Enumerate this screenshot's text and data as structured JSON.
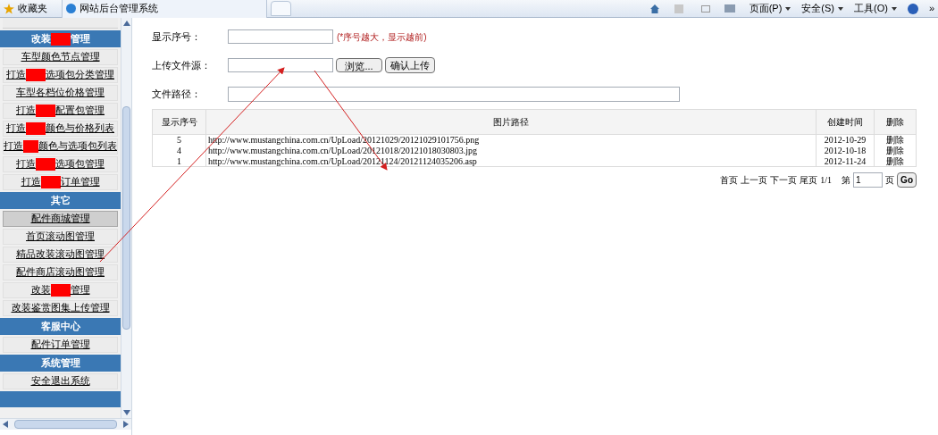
{
  "browser": {
    "favorites": "收藏夹",
    "tab": "网站后台管理系统",
    "menus": [
      "页面(P)",
      "安全(S)",
      "工具(O)"
    ],
    "more": "»"
  },
  "sidebar": {
    "sections": [
      {
        "title": {
          "before": "改装",
          "after": "管理",
          "redacted": true
        },
        "items": [
          {
            "before": "车型颜色节点管理",
            "selected": false
          },
          {
            "before": "打造",
            "after": "选项包分类管理",
            "redacted": true,
            "selected": false
          },
          {
            "before": "车型各档位价格管理",
            "selected": false
          },
          {
            "before": "打造",
            "after": "配置包管理",
            "redacted": true,
            "selected": false
          },
          {
            "before": "打造",
            "after": "颜色与价格列表",
            "redacted": true,
            "selected": false
          },
          {
            "before": "打造",
            "after": "颜色与选项包列表",
            "redacted": true,
            "selected": false
          },
          {
            "before": "打造",
            "after": "选项包管理",
            "redacted": true,
            "selected": false
          },
          {
            "before": "打造",
            "after": "订单管理",
            "redacted": true,
            "selected": false
          }
        ]
      },
      {
        "title": {
          "before": "其它"
        },
        "items": [
          {
            "before": "配件商城管理",
            "selected": true
          },
          {
            "before": "首页滚动图管理",
            "selected": false
          },
          {
            "before": "精品改装滚动图管理",
            "selected": false
          },
          {
            "before": "配件商店滚动图管理",
            "selected": false
          },
          {
            "before": "改装",
            "after": "管理",
            "redacted": true,
            "selected": false
          },
          {
            "before": "改装鉴赏图集上传管理",
            "selected": false
          }
        ]
      },
      {
        "title": {
          "before": "客服中心"
        },
        "items": [
          {
            "before": "配件订单管理",
            "selected": false
          }
        ]
      },
      {
        "title": {
          "before": "系统管理"
        },
        "items": [
          {
            "before": "安全退出系统",
            "selected": false
          }
        ]
      }
    ]
  },
  "form": {
    "order_label": "显示序号：",
    "order_hint": "(*序号越大，显示越前)",
    "upload_label": "上传文件源：",
    "browse_button": "浏览...",
    "upload_button": "确认上传",
    "path_label": "文件路径："
  },
  "table": {
    "columns": [
      "显示序号",
      "图片路径",
      "创建时间",
      "删除"
    ],
    "rows": [
      [
        "5",
        "http://www.mustangchina.com.cn/UpLoad/20121029/20121029101756.png",
        "2012-10-29",
        "删除"
      ],
      [
        "4",
        "http://www.mustangchina.com.cn/UpLoad/20121018/20121018030803.jpg",
        "2012-10-18",
        "删除"
      ],
      [
        "1",
        "http://www.mustangchina.com.cn/UpLoad/20121124/20121124035206.asp",
        "2012-11-24",
        "删除"
      ]
    ]
  },
  "pager": {
    "links": [
      "首页",
      "上一页",
      "下一页",
      "尾页"
    ],
    "count": "1/1",
    "page_prefix": "第",
    "page_value": "1",
    "page_suffix": "页",
    "go": "Go"
  }
}
